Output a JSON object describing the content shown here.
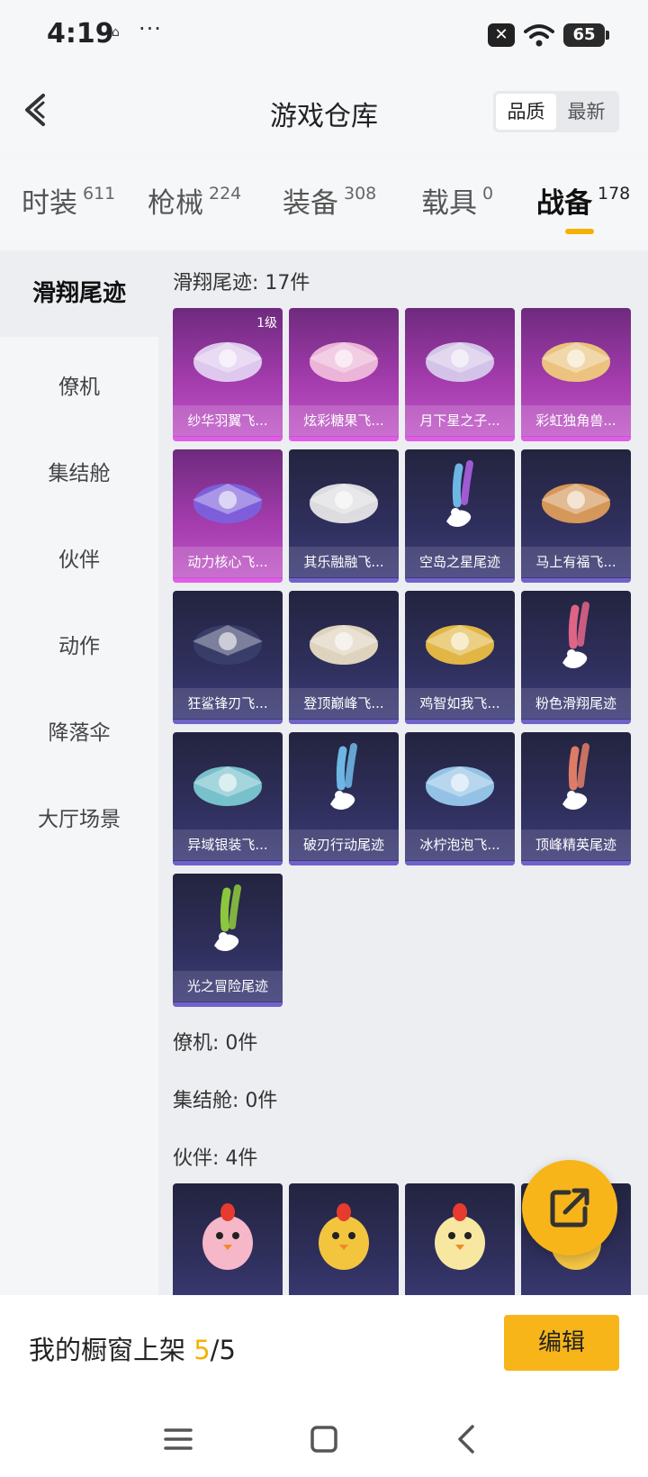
{
  "status": {
    "time": "4:19",
    "dots": "···",
    "battery": "65"
  },
  "header": {
    "title": "游戏仓库",
    "sort": [
      "品质",
      "最新"
    ]
  },
  "tabs": [
    {
      "label": "时装",
      "count": "611"
    },
    {
      "label": "枪械",
      "count": "224"
    },
    {
      "label": "装备",
      "count": "308"
    },
    {
      "label": "载具",
      "count": "0"
    },
    {
      "label": "战备",
      "count": "178"
    }
  ],
  "sidebar": [
    "滑翔尾迹",
    "僚机",
    "集结舱",
    "伙伴",
    "动作",
    "降落伞",
    "大厅场景"
  ],
  "sections": {
    "trail_title": "滑翔尾迹: 17件",
    "wingman_title": "僚机: 0件",
    "pod_title": "集结舱: 0件",
    "partner_title": "伙伴: 4件"
  },
  "trail_items": [
    {
      "name": "纱华羽翼飞...",
      "rarity": "purple",
      "level": "1级",
      "icon": "winged-glider-icon"
    },
    {
      "name": "炫彩糖果飞...",
      "rarity": "purple",
      "icon": "candy-glider-icon"
    },
    {
      "name": "月下星之子...",
      "rarity": "purple",
      "icon": "star-plane-icon"
    },
    {
      "name": "彩虹独角兽...",
      "rarity": "purple",
      "icon": "unicorn-glider-icon"
    },
    {
      "name": "动力核心飞...",
      "rarity": "purple",
      "icon": "core-jet-icon"
    },
    {
      "name": "其乐融融飞...",
      "rarity": "blue",
      "icon": "penguin-glider-icon"
    },
    {
      "name": "空岛之星尾迹",
      "rarity": "blue",
      "icon": "rainbow-trail-icon"
    },
    {
      "name": "马上有福飞...",
      "rarity": "blue",
      "icon": "horse-glider-icon"
    },
    {
      "name": "狂鲨锋刃飞...",
      "rarity": "blue",
      "icon": "shark-glider-icon"
    },
    {
      "name": "登顶巅峰飞...",
      "rarity": "blue",
      "icon": "peak-jet-icon"
    },
    {
      "name": "鸡智如我飞...",
      "rarity": "blue",
      "icon": "chicken-glider-icon"
    },
    {
      "name": "粉色滑翔尾迹",
      "rarity": "blue",
      "icon": "pink-trail-icon"
    },
    {
      "name": "异域银装飞...",
      "rarity": "blue",
      "icon": "silver-wing-icon"
    },
    {
      "name": "破刃行动尾迹",
      "rarity": "blue",
      "icon": "blade-trail-icon"
    },
    {
      "name": "冰柠泡泡飞...",
      "rarity": "blue",
      "icon": "lemon-glider-icon"
    },
    {
      "name": "顶峰精英尾迹",
      "rarity": "blue",
      "icon": "elite-trail-icon"
    },
    {
      "name": "光之冒险尾迹",
      "rarity": "blue",
      "icon": "green-trail-icon"
    }
  ],
  "partner_items": [
    {
      "icon": "pink-chick-icon"
    },
    {
      "icon": "armor-chicken-icon"
    },
    {
      "icon": "egg-chick-icon"
    },
    {
      "icon": "yellow-chick-icon"
    }
  ],
  "showcase": {
    "label": "我的橱窗上架 ",
    "current": "5",
    "total": "/5",
    "edit": "编辑"
  },
  "colors": {
    "accent": "#f5b100",
    "purple_card": "#a43cad",
    "blue_card": "#2f2f5c"
  }
}
